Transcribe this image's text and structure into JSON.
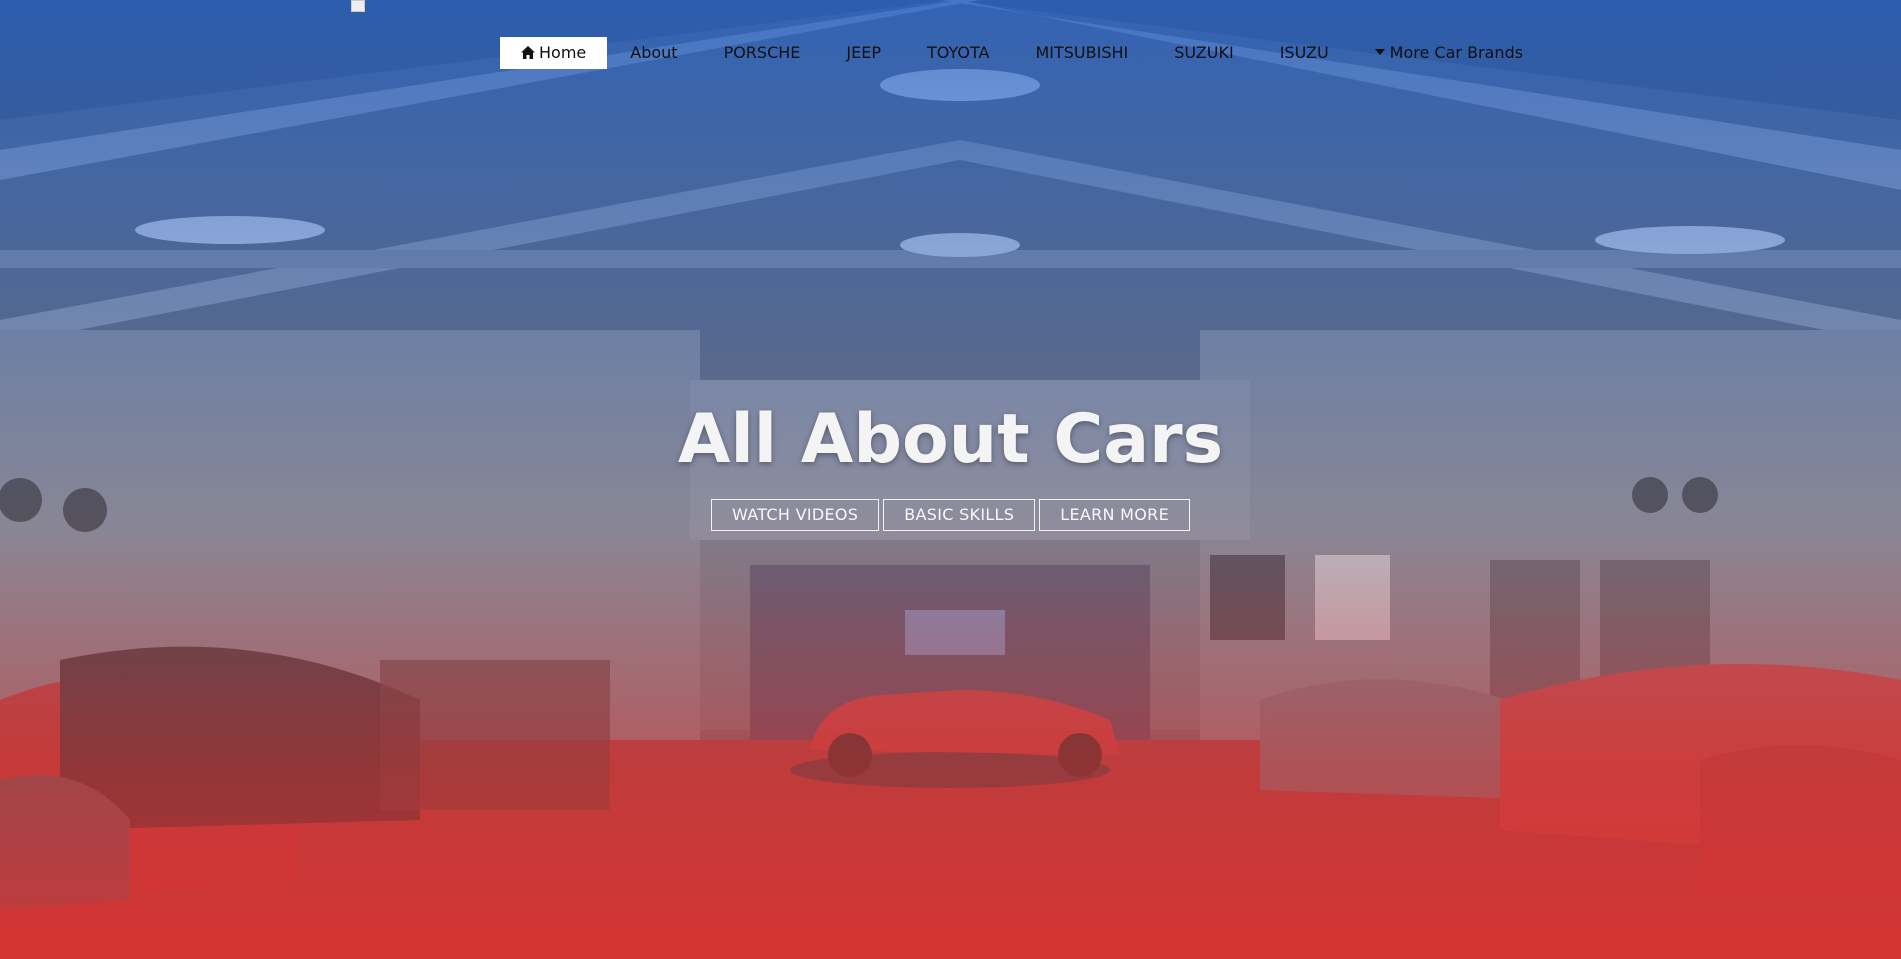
{
  "nav": {
    "items": [
      {
        "label": "Home",
        "icon": "home-icon",
        "active": true
      },
      {
        "label": "About"
      },
      {
        "label": "PORSCHE"
      },
      {
        "label": "JEEP"
      },
      {
        "label": "TOYOTA"
      },
      {
        "label": "MITSUBISHI"
      },
      {
        "label": "SUZUKI"
      },
      {
        "label": "ISUZU"
      },
      {
        "label": "More Car Brands",
        "icon": "caret-down-icon"
      }
    ]
  },
  "hero": {
    "title": "All About Cars",
    "buttons": [
      {
        "label": "WATCH VIDEOS"
      },
      {
        "label": "BASIC SKILLS"
      },
      {
        "label": "LEARN MORE"
      }
    ],
    "overlay_colors": {
      "top": "#2864c8",
      "bottom": "#dc3232"
    }
  }
}
